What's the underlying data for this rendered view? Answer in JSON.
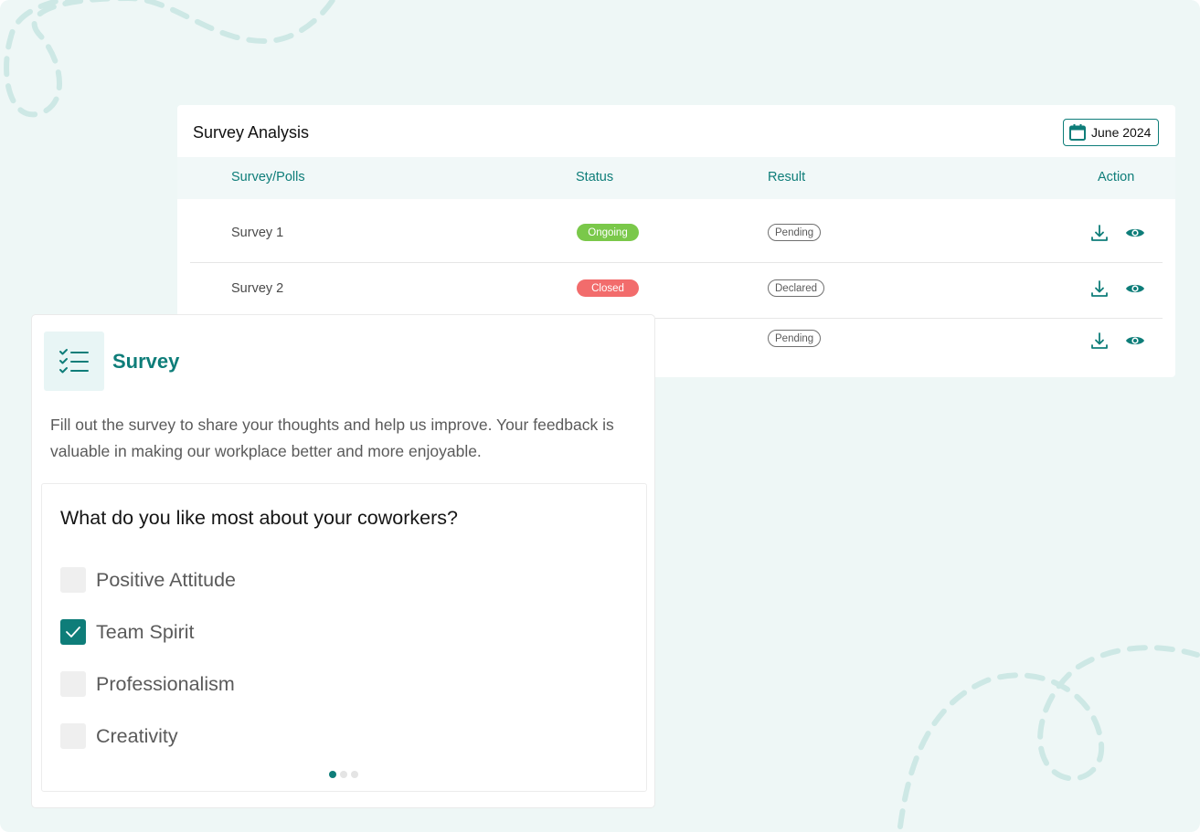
{
  "colors": {
    "accent": "#0e7d79",
    "background": "#eef7f6",
    "ongoing": "#7ac84a",
    "closed": "#f26c6c"
  },
  "analysis": {
    "title": "Survey Analysis",
    "date_label": "June 2024",
    "date_icon": "calendar-icon",
    "columns": [
      "Survey/Polls",
      "Status",
      "Result",
      "Action"
    ],
    "rows": [
      {
        "name": "Survey 1",
        "status": "Ongoing",
        "result": "Pending"
      },
      {
        "name": "Survey 2",
        "status": "Closed",
        "result": "Declared"
      },
      {
        "name": "",
        "status": "",
        "result": "Pending"
      }
    ],
    "action_icons": [
      "download-icon",
      "eye-icon"
    ]
  },
  "survey": {
    "icon": "checklist-icon",
    "title": "Survey",
    "description": "Fill out the survey to share your thoughts and help us improve. Your feedback is valuable in making our workplace better and more enjoyable.",
    "question": "What do you like most about your coworkers?",
    "options": [
      {
        "label": "Positive Attitude",
        "checked": false
      },
      {
        "label": "Team Spirit",
        "checked": true
      },
      {
        "label": "Professionalism",
        "checked": false
      },
      {
        "label": "Creativity",
        "checked": false
      }
    ],
    "pager": {
      "total": 3,
      "current": 1
    }
  }
}
